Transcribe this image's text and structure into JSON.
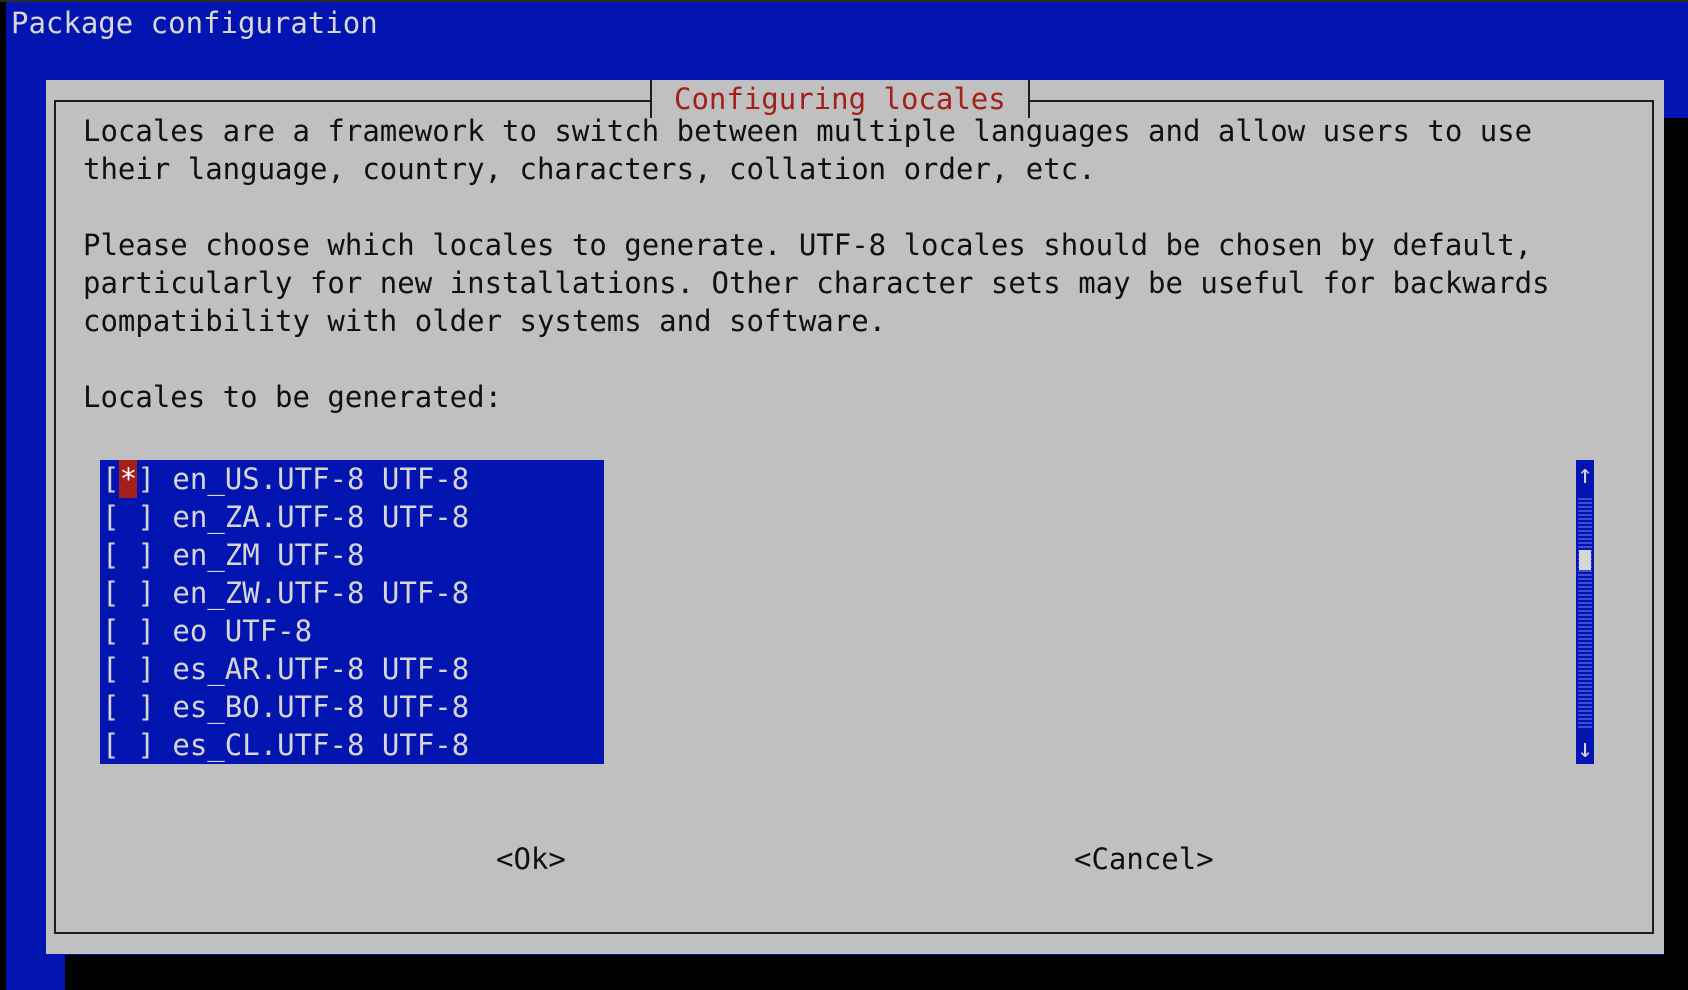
{
  "window": {
    "title": "Package configuration"
  },
  "dialog": {
    "title": "Configuring locales",
    "description_lines": [
      "Locales are a framework to switch between multiple languages and allow users to use",
      "their language, country, characters, collation order, etc."
    ],
    "instruction_lines": [
      "Please choose which locales to generate. UTF-8 locales should be chosen by default,",
      "particularly for new installations. Other character sets may be useful for backwards",
      "compatibility with older systems and software."
    ],
    "list_label": "Locales to be generated:",
    "locales": [
      {
        "checked": true,
        "mark": "*",
        "name": "en_US.UTF-8 UTF-8"
      },
      {
        "checked": false,
        "mark": " ",
        "name": "en_ZA.UTF-8 UTF-8"
      },
      {
        "checked": false,
        "mark": " ",
        "name": "en_ZM UTF-8"
      },
      {
        "checked": false,
        "mark": " ",
        "name": "en_ZW.UTF-8 UTF-8"
      },
      {
        "checked": false,
        "mark": " ",
        "name": "eo UTF-8"
      },
      {
        "checked": false,
        "mark": " ",
        "name": "es_AR.UTF-8 UTF-8"
      },
      {
        "checked": false,
        "mark": " ",
        "name": "es_BO.UTF-8 UTF-8"
      },
      {
        "checked": false,
        "mark": " ",
        "name": "es_CL.UTF-8 UTF-8"
      }
    ],
    "scrollbar": {
      "up_icon": "↑",
      "down_icon": "↓"
    },
    "buttons": {
      "ok_label": "<Ok>",
      "cancel_label": "<Cancel>"
    }
  },
  "colors": {
    "backdrop": "#0315B1",
    "dialog_bg": "#C0C0C0",
    "title_red": "#A41F1A",
    "list_bg": "#0315B1"
  }
}
